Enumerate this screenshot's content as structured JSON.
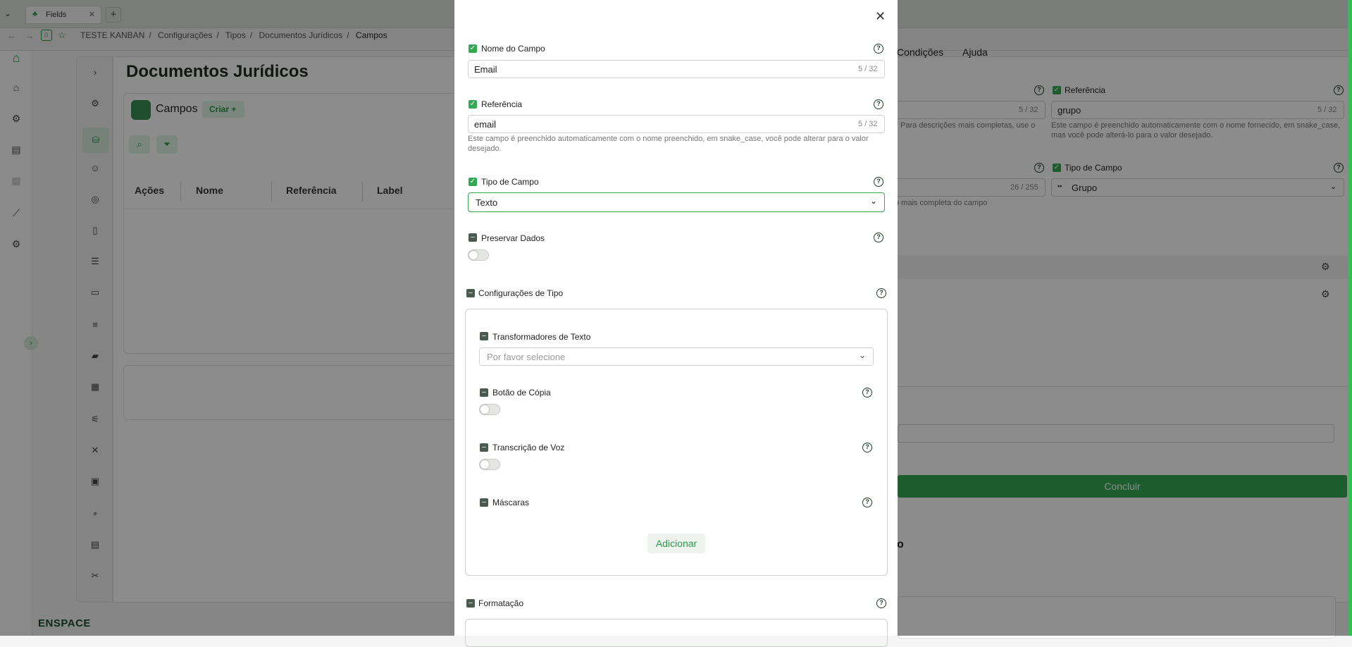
{
  "browser": {
    "tab_title": "Fields",
    "new_tab": "+",
    "breadcrumb": [
      "TESTE KANBAN",
      "Configurações",
      "Tipos",
      "Documentos Jurídicos",
      "Campos"
    ]
  },
  "page": {
    "title": "Documentos Jurídicos",
    "section_label": "Campos",
    "create_button": "Criar +",
    "table_headers": [
      "Ações",
      "Nome",
      "Referência",
      "Label"
    ],
    "logo_text": "ENSPACE"
  },
  "background_panel": {
    "tabs": [
      "Condições",
      "Ajuda"
    ],
    "referencia_label": "Referência",
    "referencia_value": "grupo",
    "referencia_count": "5 / 32",
    "referencia_help": "Este campo é preenchido automaticamente com o nome fornecido, em snake_case, mas você pode alterá-lo para o valor desejado.",
    "left_count": "5 / 32",
    "left_help": "Para descrições mais completas, use o",
    "tipo_label": "Tipo de Campo",
    "tipo_value": "Grupo",
    "desc_count": "26 / 255",
    "desc_help": "o mais completa do campo",
    "concluir": "Concluir",
    "partial_char": "o"
  },
  "modal": {
    "close": "✕",
    "nome_label": "Nome do Campo",
    "nome_value": "Email",
    "nome_count": "5 / 32",
    "ref_label": "Referência",
    "ref_value": "email",
    "ref_count": "5 / 32",
    "ref_help": "Este campo é preenchido automaticamente com o nome preenchido, em snake_case, você pode alterar para o valor desejado.",
    "tipo_label": "Tipo de Campo",
    "tipo_value": "Texto",
    "preservar_label": "Preservar Dados",
    "config_label": "Configurações de Tipo",
    "transformadores_label": "Transformadores de Texto",
    "transformadores_placeholder": "Por favor selecione",
    "copia_label": "Botão de Cópia",
    "voz_label": "Transcrição de Voz",
    "mascaras_label": "Máscaras",
    "adicionar": "Adicionar",
    "formatacao_label": "Formatação"
  }
}
